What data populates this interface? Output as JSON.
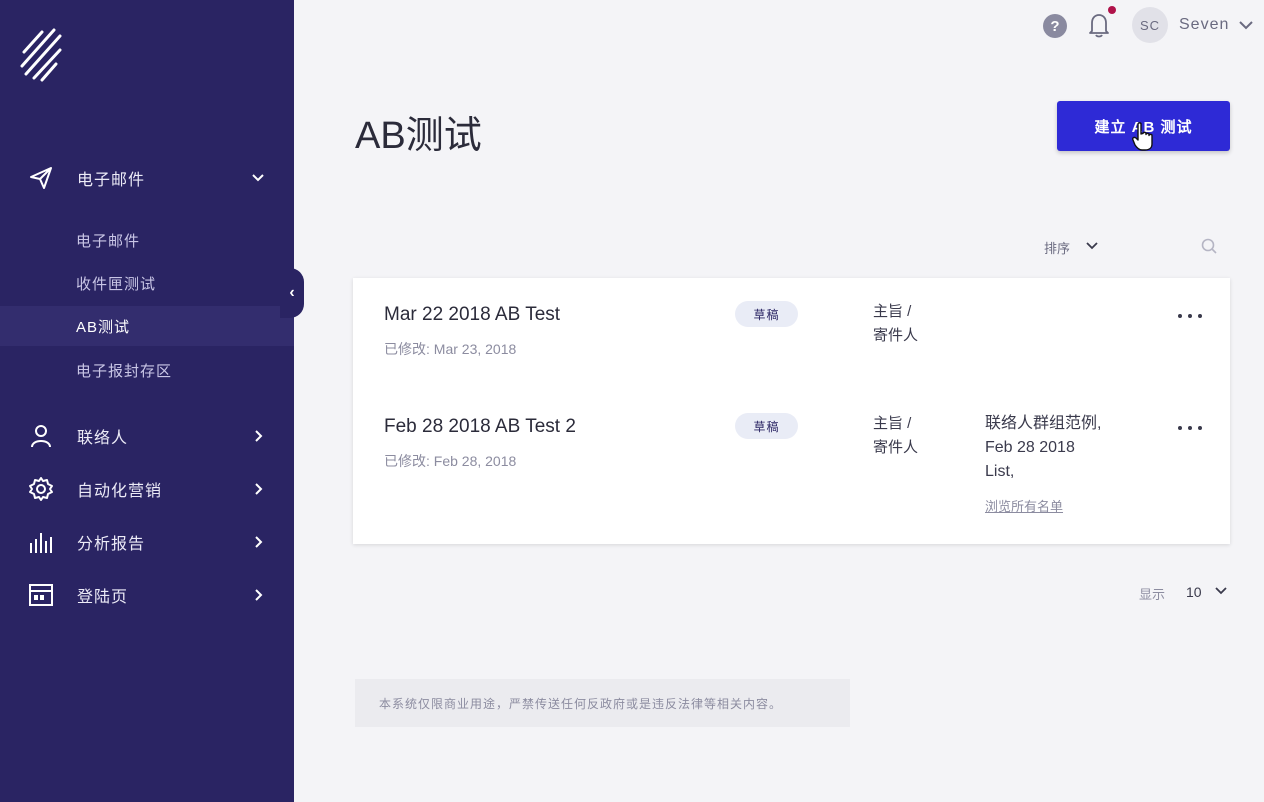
{
  "sidebar": {
    "logo_icon": "slash-lines-logo",
    "sections": [
      {
        "label": "电子邮件",
        "icon": "paper-plane-icon",
        "expanded": true
      },
      {
        "label": "联络人",
        "icon": "user-icon",
        "expanded": false
      },
      {
        "label": "自动化营销",
        "icon": "gear-icon",
        "expanded": false
      },
      {
        "label": "分析报告",
        "icon": "bar-chart-icon",
        "expanded": false
      },
      {
        "label": "登陆页",
        "icon": "layout-icon",
        "expanded": false
      }
    ],
    "email_subitems": [
      {
        "label": "电子邮件",
        "active": false
      },
      {
        "label": "收件匣测试",
        "active": false
      },
      {
        "label": "AB测试",
        "active": true
      },
      {
        "label": "电子报封存区",
        "active": false
      }
    ],
    "collapse_glyph": "‹"
  },
  "topbar": {
    "help_glyph": "?",
    "avatar_initials": "SC",
    "username": "Seven",
    "notification_dot_color": "#b0124a"
  },
  "main": {
    "title": "AB测试",
    "create_button_label": "建立 AB 测试",
    "sort_label": "排序",
    "tests": [
      {
        "name": "Mar 22 2018 AB Test",
        "modified": "已修改: Mar 23, 2018",
        "status": "草稿",
        "type_line1": "主旨 /",
        "type_line2": "寄件人",
        "list_lines": [],
        "view_all": ""
      },
      {
        "name": "Feb 28 2018 AB Test 2",
        "modified": "已修改: Feb 28, 2018",
        "status": "草稿",
        "type_line1": "主旨 /",
        "type_line2": "寄件人",
        "list_lines": [
          "联络人群组范例,",
          "Feb 28 2018",
          "List,"
        ],
        "view_all": "浏览所有名单"
      }
    ],
    "pagination": {
      "show_label": "显示",
      "page_size": "10"
    },
    "footer_note": "本系统仅限商业用途，严禁传送任何反政府或是违反法律等相关内容。"
  },
  "colors": {
    "sidebar_bg": "#2a2463",
    "primary_button": "#2e2ad6",
    "page_bg": "#f4f4f7"
  }
}
